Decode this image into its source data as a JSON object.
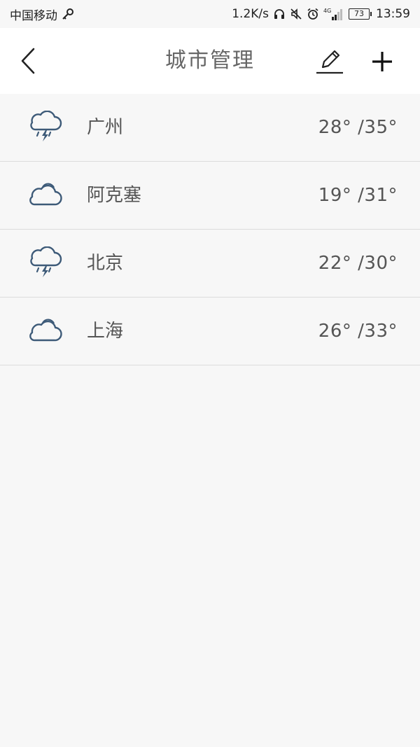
{
  "status_bar": {
    "carrier": "中国移动",
    "net_speed": "1.2K/s",
    "network": "4G",
    "battery": "73",
    "time": "13:59",
    "icons": [
      "key-icon",
      "headphones-icon",
      "mute-icon",
      "alarm-icon",
      "signal-icon"
    ]
  },
  "header": {
    "title": "城市管理",
    "back_icon": "chevron-left-icon",
    "edit_icon": "pencil-icon",
    "add_icon": "plus-icon"
  },
  "cities": [
    {
      "name": "广州",
      "temp": "28° /35°",
      "icon": "thunder-rain-icon"
    },
    {
      "name": "阿克塞",
      "temp": "19° /31°",
      "icon": "cloud-icon"
    },
    {
      "name": "北京",
      "temp": "22° /30°",
      "icon": "thunder-rain-icon"
    },
    {
      "name": "上海",
      "temp": "26° /33°",
      "icon": "cloud-icon"
    }
  ],
  "colors": {
    "icon": "#3d5a78",
    "background": "#f7f7f7",
    "header": "#ffffff",
    "divider": "#dcdcdc"
  }
}
